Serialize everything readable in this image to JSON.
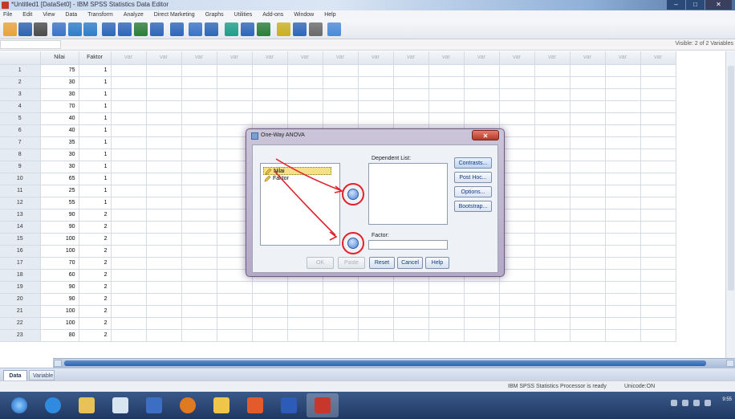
{
  "window": {
    "title": "*Untitled1 [DataSet0] - IBM SPSS Statistics Data Editor",
    "controls": [
      "–",
      "□",
      "✕"
    ]
  },
  "menubar": [
    "File",
    "Edit",
    "View",
    "Data",
    "Transform",
    "Analyze",
    "Direct Marketing",
    "Graphs",
    "Utilities",
    "Add-ons",
    "Window",
    "Help"
  ],
  "toolbar": {
    "icons": [
      "open-icon",
      "save-icon",
      "print-icon",
      "dialog-recall-icon",
      "undo-icon",
      "redo-icon",
      "goto-case-icon",
      "goto-variable-icon",
      "variables-icon",
      "run-descriptives-icon",
      "find-icon",
      "insert-cases-icon",
      "insert-variable-icon",
      "split-file-icon",
      "weight-cases-icon",
      "select-cases-icon",
      "value-labels-icon",
      "use-sets-icon",
      "show-all-icon",
      "spelling-icon"
    ],
    "colors": [
      "#e8a33a",
      "#2f62b0",
      "#4a4a4a",
      "#3a73c6",
      "#2e7ec8",
      "#2e7ec8",
      "#2e66b8",
      "#2e66b8",
      "#2a7e3a",
      "#2e66b8",
      "#2e66b8",
      "#3a73c6",
      "#2e66b8",
      "#1e9e8a",
      "#2e66b8",
      "#2a7e3a",
      "#c9b021",
      "#2e66b8",
      "#6a6a6a",
      "#4a8ad8"
    ]
  },
  "cellrow": {
    "visible": "Visible: 2 of 2 Variables"
  },
  "grid": {
    "columns": [
      "Nilai",
      "Faktor",
      "var",
      "var",
      "var",
      "var",
      "var",
      "var",
      "var",
      "var",
      "var",
      "var",
      "var",
      "var",
      "var",
      "var",
      "var",
      "var"
    ],
    "rows": [
      {
        "n": "1",
        "nilai": "75",
        "faktor": "1"
      },
      {
        "n": "2",
        "nilai": "30",
        "faktor": "1"
      },
      {
        "n": "3",
        "nilai": "30",
        "faktor": "1"
      },
      {
        "n": "4",
        "nilai": "70",
        "faktor": "1"
      },
      {
        "n": "5",
        "nilai": "40",
        "faktor": "1"
      },
      {
        "n": "6",
        "nilai": "40",
        "faktor": "1"
      },
      {
        "n": "7",
        "nilai": "35",
        "faktor": "1"
      },
      {
        "n": "8",
        "nilai": "30",
        "faktor": "1"
      },
      {
        "n": "9",
        "nilai": "30",
        "faktor": "1"
      },
      {
        "n": "10",
        "nilai": "65",
        "faktor": "1"
      },
      {
        "n": "11",
        "nilai": "25",
        "faktor": "1"
      },
      {
        "n": "12",
        "nilai": "55",
        "faktor": "1"
      },
      {
        "n": "13",
        "nilai": "90",
        "faktor": "2"
      },
      {
        "n": "14",
        "nilai": "90",
        "faktor": "2"
      },
      {
        "n": "15",
        "nilai": "100",
        "faktor": "2"
      },
      {
        "n": "16",
        "nilai": "100",
        "faktor": "2"
      },
      {
        "n": "17",
        "nilai": "70",
        "faktor": "2"
      },
      {
        "n": "18",
        "nilai": "60",
        "faktor": "2"
      },
      {
        "n": "19",
        "nilai": "90",
        "faktor": "2"
      },
      {
        "n": "20",
        "nilai": "90",
        "faktor": "2"
      },
      {
        "n": "21",
        "nilai": "100",
        "faktor": "2"
      },
      {
        "n": "22",
        "nilai": "100",
        "faktor": "2"
      },
      {
        "n": "23",
        "nilai": "80",
        "faktor": "2"
      }
    ]
  },
  "tabs": {
    "data_view": "Data View",
    "variable_view": "Variable View"
  },
  "status": {
    "processor": "IBM SPSS Statistics Processor is ready",
    "unicode": "Unicode:ON"
  },
  "dialog": {
    "title": "One-Way ANOVA",
    "close": "✕",
    "source_variables": [
      "Nilai",
      "Faktor"
    ],
    "dependent_list_label": "Dependent List:",
    "factor_label": "Factor:",
    "side_buttons": [
      "Contrasts...",
      "Post Hoc...",
      "Options...",
      "Bootstrap..."
    ],
    "bottom_buttons": [
      "OK",
      "Paste",
      "Reset",
      "Cancel",
      "Help"
    ]
  },
  "annotation_color": "#e0212a",
  "taskbar": {
    "apps": [
      "start-orb-icon",
      "internet-explorer-icon",
      "explorer-folder-icon",
      "notepad-icon",
      "media-player-icon",
      "firefox-icon",
      "paint-icon",
      "office-icon",
      "word-icon",
      "spss-icon"
    ],
    "clock": "9:55"
  }
}
